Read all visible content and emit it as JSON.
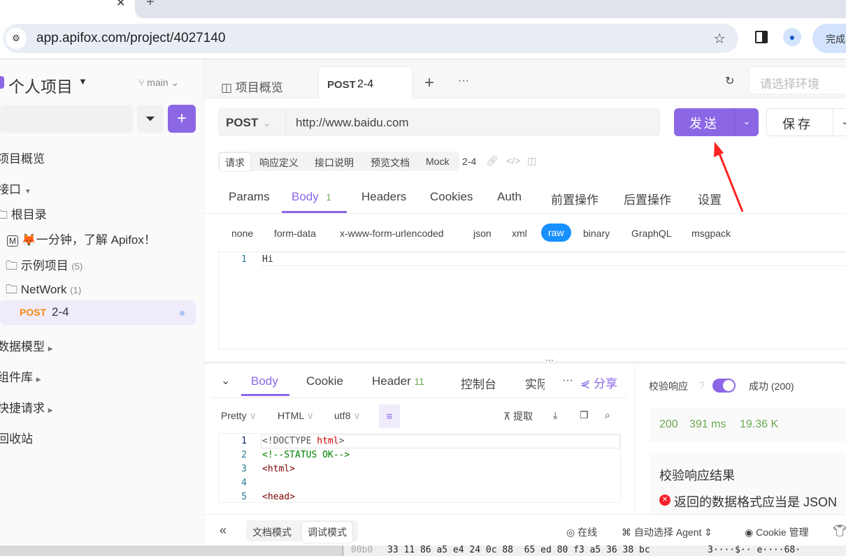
{
  "browser": {
    "url": "app.apifox.com/project/4027140",
    "profile_button": "完成"
  },
  "sidebar": {
    "project": "个人项目",
    "branch": "main",
    "items": [
      {
        "label": "项目概览"
      },
      {
        "label": "接口"
      },
      {
        "label": "根目录"
      },
      {
        "label": "🦊一分钟，了解 Apifox！"
      },
      {
        "label": "示例项目",
        "count": "(5)"
      },
      {
        "label": "NetWork",
        "count": "(1)"
      },
      {
        "method": "POST",
        "label": "2-4"
      },
      {
        "label": "数据模型"
      },
      {
        "label": "组件库"
      },
      {
        "label": "快捷请求"
      },
      {
        "label": "回收站"
      }
    ]
  },
  "tabs": {
    "overview": "项目概览",
    "active_method": "POST",
    "active_name": "2-4",
    "env_placeholder": "请选择环境"
  },
  "request": {
    "method": "POST",
    "url": "http://www.baidu.com",
    "send": "发送",
    "save": "保存"
  },
  "subtabs": [
    "请求",
    "响应定义",
    "接口说明",
    "预览文档",
    "Mock"
  ],
  "subtab_name": "2-4",
  "param_tabs": [
    "Params",
    "Body",
    "Headers",
    "Cookies",
    "Auth",
    "前置操作",
    "后置操作",
    "设置"
  ],
  "body_count": "1",
  "body_types": [
    "none",
    "form-data",
    "x-www-form-urlencoded",
    "json",
    "xml",
    "raw",
    "binary",
    "GraphQL",
    "msgpack"
  ],
  "body_editor": {
    "lines": [
      {
        "n": "1",
        "text": "Hi"
      }
    ]
  },
  "response": {
    "tabs": [
      "Body",
      "Cookie",
      "Header",
      "控制台",
      "实际"
    ],
    "header_count": "11",
    "share": "分享",
    "format": [
      "Pretty",
      "HTML",
      "utf8"
    ],
    "extract": "提取",
    "lines": [
      {
        "n": "1",
        "parts": [
          [
            "<!DOCTYPE ",
            "#555"
          ],
          [
            "html",
            "#c00"
          ],
          [
            ">",
            "#555"
          ]
        ]
      },
      {
        "n": "2",
        "parts": [
          [
            "<!--STATUS OK-->",
            "#008000"
          ]
        ]
      },
      {
        "n": "3",
        "parts": [
          [
            "<html>",
            "#800000"
          ]
        ]
      },
      {
        "n": "4",
        "parts": []
      },
      {
        "n": "5",
        "parts": [
          [
            "<head>",
            "#800000"
          ]
        ]
      }
    ]
  },
  "validation": {
    "label": "校验响应",
    "enabled": true,
    "status": "成功 (200)",
    "code": "200",
    "time": "391 ms",
    "size": "19.36 K",
    "result_title": "校验响应结果",
    "error": "返回的数据格式应当是 JSON"
  },
  "footer": {
    "doc_mode": "文档模式",
    "debug_mode": "调试模式",
    "online": "在线",
    "agent": "自动选择 Agent",
    "cookie": "Cookie 管理"
  },
  "hex_strip": {
    "offset": "00b0",
    "bytes": "33 11 86 a5 e4 24 0c 88  65 ed 80 f3 a5 36 38 bc",
    "ascii": "3····$·· e····68·"
  },
  "colors": {
    "accent": "#8b67e6",
    "method": "#f7890c",
    "success": "#6aa84f",
    "error": "#f5222d"
  }
}
